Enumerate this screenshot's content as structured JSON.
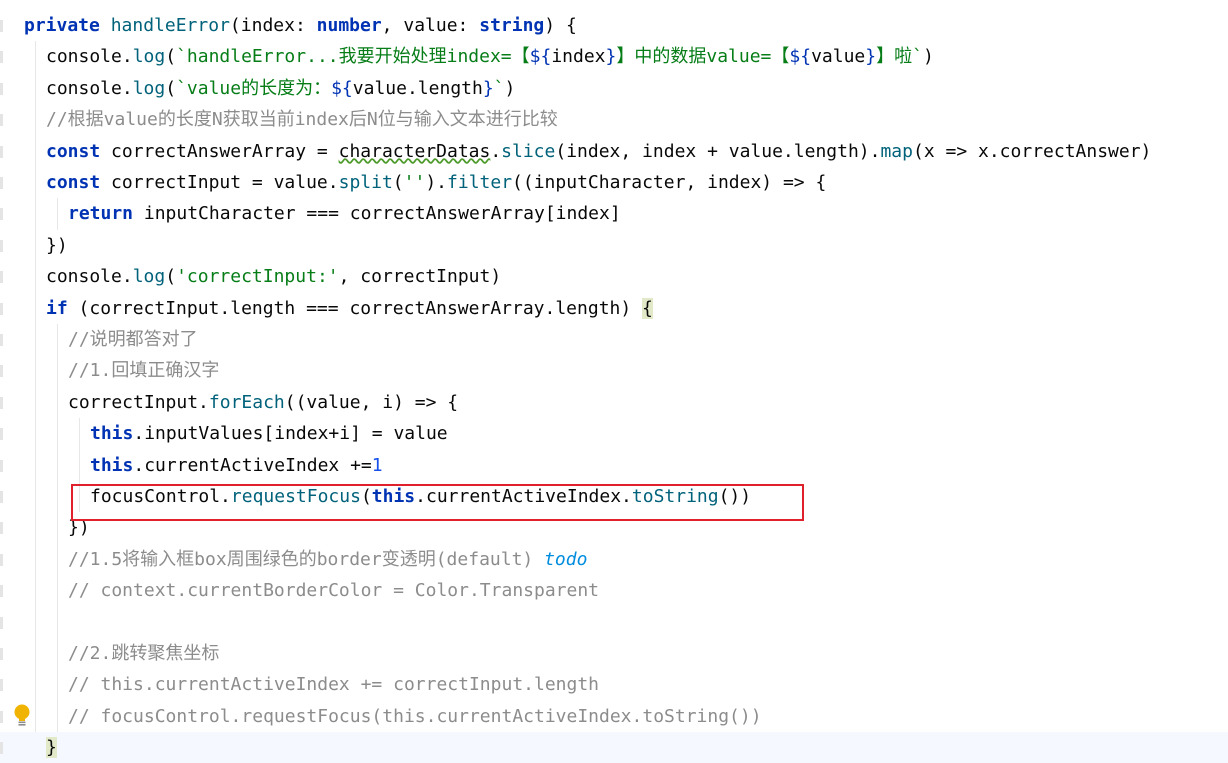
{
  "editor": {
    "lines": [
      {
        "indent": "",
        "tokens": [
          {
            "t": "private ",
            "c": "kw"
          },
          {
            "t": "handleError",
            "c": "fn"
          },
          {
            "t": "(",
            "c": "punc"
          },
          {
            "t": "index",
            "c": "param"
          },
          {
            "t": ": ",
            "c": "punc"
          },
          {
            "t": "number",
            "c": "kw"
          },
          {
            "t": ", ",
            "c": "punc"
          },
          {
            "t": "value",
            "c": "param"
          },
          {
            "t": ": ",
            "c": "punc"
          },
          {
            "t": "string",
            "c": "kw"
          },
          {
            "t": ") {",
            "c": "punc"
          }
        ]
      },
      {
        "indent": "  ",
        "tokens": [
          {
            "t": "console.",
            "c": "punc"
          },
          {
            "t": "log",
            "c": "mcall"
          },
          {
            "t": "(",
            "c": "punc"
          },
          {
            "t": "`handleError...我要开始处理index=【",
            "c": "tpl"
          },
          {
            "t": "${",
            "c": "interp"
          },
          {
            "t": "index",
            "c": "punc"
          },
          {
            "t": "}",
            "c": "interp"
          },
          {
            "t": "】中的数据value=【",
            "c": "tpl"
          },
          {
            "t": "${",
            "c": "interp"
          },
          {
            "t": "value",
            "c": "punc"
          },
          {
            "t": "}",
            "c": "interp"
          },
          {
            "t": "】啦`",
            "c": "tpl"
          },
          {
            "t": ")",
            "c": "punc"
          }
        ]
      },
      {
        "indent": "  ",
        "tokens": [
          {
            "t": "console.",
            "c": "punc"
          },
          {
            "t": "log",
            "c": "mcall"
          },
          {
            "t": "(",
            "c": "punc"
          },
          {
            "t": "`value的长度为：",
            "c": "tpl"
          },
          {
            "t": "${",
            "c": "interp"
          },
          {
            "t": "value.length",
            "c": "punc"
          },
          {
            "t": "}",
            "c": "interp"
          },
          {
            "t": "`",
            "c": "tpl"
          },
          {
            "t": ")",
            "c": "punc"
          }
        ]
      },
      {
        "indent": "  ",
        "tokens": [
          {
            "t": "//根据value的长度N获取当前index后N位与输入文本进行比较",
            "c": "cm"
          }
        ]
      },
      {
        "indent": "  ",
        "tokens": [
          {
            "t": "const ",
            "c": "kw"
          },
          {
            "t": "correctAnswerArray = ",
            "c": "punc"
          },
          {
            "t": "characterDatas",
            "c": "squiggle"
          },
          {
            "t": ".",
            "c": "punc"
          },
          {
            "t": "slice",
            "c": "mcall"
          },
          {
            "t": "(index, index + value.length).",
            "c": "punc"
          },
          {
            "t": "map",
            "c": "mcall"
          },
          {
            "t": "(x => x.correctAnswer)",
            "c": "punc"
          }
        ]
      },
      {
        "indent": "  ",
        "tokens": [
          {
            "t": "const ",
            "c": "kw"
          },
          {
            "t": "correctInput = value.",
            "c": "punc"
          },
          {
            "t": "split",
            "c": "mcall"
          },
          {
            "t": "(",
            "c": "punc"
          },
          {
            "t": "''",
            "c": "str"
          },
          {
            "t": ").",
            "c": "punc"
          },
          {
            "t": "filter",
            "c": "mcall"
          },
          {
            "t": "((inputCharacter, index) => {",
            "c": "punc"
          }
        ]
      },
      {
        "indent": "    ",
        "tokens": [
          {
            "t": "return ",
            "c": "kw"
          },
          {
            "t": "inputCharacter === correctAnswerArray[index]",
            "c": "punc"
          }
        ]
      },
      {
        "indent": "  ",
        "tokens": [
          {
            "t": "})",
            "c": "punc"
          }
        ]
      },
      {
        "indent": "  ",
        "tokens": [
          {
            "t": "console.",
            "c": "punc"
          },
          {
            "t": "log",
            "c": "mcall"
          },
          {
            "t": "(",
            "c": "punc"
          },
          {
            "t": "'correctInput:'",
            "c": "str"
          },
          {
            "t": ", correctInput)",
            "c": "punc"
          }
        ]
      },
      {
        "indent": "  ",
        "tokens": [
          {
            "t": "if ",
            "c": "kw"
          },
          {
            "t": "(correctInput.length === correctAnswerArray.length) ",
            "c": "punc"
          },
          {
            "t": "{",
            "c": "hl-brace"
          }
        ]
      },
      {
        "indent": "    ",
        "tokens": [
          {
            "t": "//说明都答对了",
            "c": "cm"
          }
        ]
      },
      {
        "indent": "    ",
        "tokens": [
          {
            "t": "//1.回填正确汉字",
            "c": "cm"
          }
        ]
      },
      {
        "indent": "    ",
        "tokens": [
          {
            "t": "correctInput.",
            "c": "punc"
          },
          {
            "t": "forEach",
            "c": "mcall"
          },
          {
            "t": "((value, i) => {",
            "c": "punc"
          }
        ]
      },
      {
        "indent": "      ",
        "tokens": [
          {
            "t": "this",
            "c": "kw"
          },
          {
            "t": ".inputValues[index+i] = value",
            "c": "punc"
          }
        ]
      },
      {
        "indent": "      ",
        "tokens": [
          {
            "t": "this",
            "c": "kw"
          },
          {
            "t": ".currentActiveIndex +=",
            "c": "punc"
          },
          {
            "t": "1",
            "c": "num"
          }
        ]
      },
      {
        "indent": "      ",
        "tokens": [
          {
            "t": "focusControl.",
            "c": "punc"
          },
          {
            "t": "requestFocus",
            "c": "mcall"
          },
          {
            "t": "(",
            "c": "punc"
          },
          {
            "t": "this",
            "c": "kw"
          },
          {
            "t": ".currentActiveIndex.",
            "c": "punc"
          },
          {
            "t": "toString",
            "c": "mcall"
          },
          {
            "t": "())",
            "c": "punc"
          }
        ]
      },
      {
        "indent": "    ",
        "tokens": [
          {
            "t": "})",
            "c": "punc"
          }
        ]
      },
      {
        "indent": "    ",
        "tokens": [
          {
            "t": "//1.5将输入框box周围绿色的border变透明(default) ",
            "c": "cm"
          },
          {
            "t": "todo",
            "c": "cmt-todo"
          }
        ]
      },
      {
        "indent": "    ",
        "tokens": [
          {
            "t": "// context.currentBorderColor = Color.Transparent",
            "c": "cm"
          }
        ]
      },
      {
        "indent": "",
        "tokens": []
      },
      {
        "indent": "    ",
        "tokens": [
          {
            "t": "//2.跳转聚焦坐标",
            "c": "cm"
          }
        ]
      },
      {
        "indent": "    ",
        "tokens": [
          {
            "t": "// this.currentActiveIndex += correctInput.length",
            "c": "cm"
          }
        ]
      },
      {
        "indent": "    ",
        "tokens": [
          {
            "t": "// focusControl.requestFocus(this.currentActiveIndex.toString())",
            "c": "cm"
          }
        ]
      },
      {
        "indent": "  ",
        "tokens": [
          {
            "t": "}",
            "c": "hl-brace"
          }
        ]
      }
    ],
    "highlighted_line": 15,
    "current_line": 23,
    "icons": {
      "bulb": "lightbulb-icon"
    }
  }
}
